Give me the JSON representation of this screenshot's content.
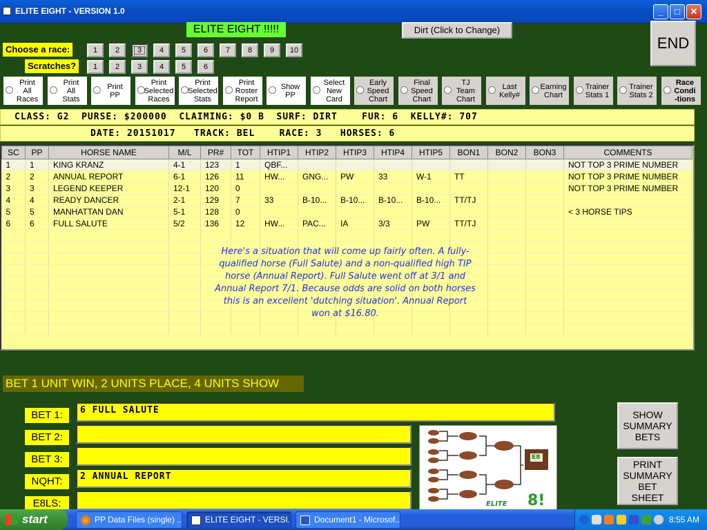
{
  "window": {
    "title": "ELITE EIGHT - VERSION 1.0"
  },
  "header": {
    "app_label": "ELITE EIGHT !!!!!",
    "surface_button": "Dirt (Click to Change)",
    "end_button": "END"
  },
  "race_select": {
    "label": "Choose  a race:",
    "races": [
      "1",
      "2",
      "3",
      "4",
      "5",
      "6",
      "7",
      "8",
      "9",
      "10"
    ],
    "selected": "3"
  },
  "scratches": {
    "label": "Scratches?",
    "buttons": [
      "1",
      "2",
      "3",
      "4",
      "5",
      "6"
    ]
  },
  "options": [
    {
      "label": "Print\nAll\nRaces",
      "style": "white"
    },
    {
      "label": "Print\nAll\nStats",
      "style": "white"
    },
    {
      "label": "Print\nPP",
      "style": "white"
    },
    {
      "label": "Print\nSelected\nRaces",
      "style": "white"
    },
    {
      "label": "Print\nSelected\nStats",
      "style": "white"
    },
    {
      "label": "Print\nRoster\nReport",
      "style": "white"
    },
    {
      "label": "Show\nPP",
      "style": "white"
    },
    {
      "label": "Select\nNew\nCard",
      "style": "white"
    },
    {
      "label": "Early\nSpeed\nChart",
      "style": "grey"
    },
    {
      "label": "Final\nSpeed\nChart",
      "style": "grey"
    },
    {
      "label": "TJ\nTeam\nChart",
      "style": "grey"
    },
    {
      "label": "Last\nKelly#",
      "style": "grey"
    },
    {
      "label": "Earning\nChart",
      "style": "grey"
    },
    {
      "label": "Trainer\nStats 1",
      "style": "grey"
    },
    {
      "label": "Trainer\nStats 2",
      "style": "grey"
    },
    {
      "label": "Race\nCondi\n-tions",
      "style": "grey-bold"
    }
  ],
  "race_info": {
    "line1": "CLASS: G2  PURSE: $200000  CLAIMING: $0 B  SURF: DIRT    FUR: 6  KELLY#: 707",
    "line2": "DATE: 20151017   TRACK: BEL    RACE: 3   HORSES: 6"
  },
  "table": {
    "columns": [
      "SC",
      "PP",
      "HORSE NAME",
      "M/L",
      "PR#",
      "TOT",
      "HTIP1",
      "HTIP2",
      "HTIP3",
      "HTIP4",
      "HTIP5",
      "BON1",
      "BON2",
      "BON3",
      "COMMENTS"
    ],
    "rows": [
      [
        "1",
        "1",
        "KING KRANZ",
        "4-1",
        "123",
        "1",
        "QBF...",
        "",
        "",
        "",
        "",
        "",
        "",
        "",
        "NOT TOP 3 PRIME NUMBER"
      ],
      [
        "2",
        "2",
        "ANNUAL REPORT",
        "6-1",
        "126",
        "11",
        "HW...",
        "GNG...",
        "PW",
        "33",
        "W-1",
        "TT",
        "",
        "",
        "NOT TOP 3 PRIME NUMBER"
      ],
      [
        "3",
        "3",
        "LEGEND KEEPER",
        "12-1",
        "120",
        "0",
        "",
        "",
        "",
        "",
        "",
        "",
        "",
        "",
        "NOT TOP 3 PRIME NUMBER"
      ],
      [
        "4",
        "4",
        "READY DANCER",
        "2-1",
        "129",
        "7",
        "33",
        "B-10...",
        "B-10...",
        "B-10...",
        "B-10...",
        "TT/TJ",
        "",
        "",
        ""
      ],
      [
        "5",
        "5",
        "MANHATTAN DAN",
        "5-1",
        "128",
        "0",
        "",
        "",
        "",
        "",
        "",
        "",
        "",
        "",
        "< 3 HORSE TIPS"
      ],
      [
        "6",
        "6",
        "FULL SALUTE",
        "5/2",
        "136",
        "12",
        "HW...",
        "PAC...",
        "IA",
        "3/3",
        "PW",
        "TT/TJ",
        "",
        "",
        ""
      ]
    ]
  },
  "note": "Here's a situation that will come up fairly often.  A fully-qualified horse (Full Salute) and a non-qualified high TIP horse (Annual Report).  Full Salute went off at 3/1 and Annual Report 7/1.  Because odds are solid on both horses this is an excellent 'dutching situation'.  Annual Report won at $16.80.",
  "bets": {
    "banner": "BET 1 UNIT WIN, 2 UNITS PLACE, 4 UNITS SHOW",
    "rows": [
      {
        "label": "BET 1:",
        "value": "6 FULL SALUTE"
      },
      {
        "label": "BET 2:",
        "value": ""
      },
      {
        "label": "BET 3:",
        "value": ""
      },
      {
        "label": "NQHT:",
        "value": "2 ANNUAL REPORT"
      },
      {
        "label": "E8LS:",
        "value": ""
      }
    ]
  },
  "logo": {
    "text_elite": "ELITE",
    "text_8": "8!",
    "badge": "E8"
  },
  "side_buttons": {
    "show_summary": "SHOW\nSUMMARY\nBETS",
    "print_summary": "PRINT\nSUMMARY\nBET\nSHEET"
  },
  "taskbar": {
    "start": "start",
    "tasks": [
      "PP Data Files (single) ...",
      "ELITE EIGHT - VERSI...",
      "Document1 - Microsof..."
    ],
    "clock": "8:55 AM"
  }
}
